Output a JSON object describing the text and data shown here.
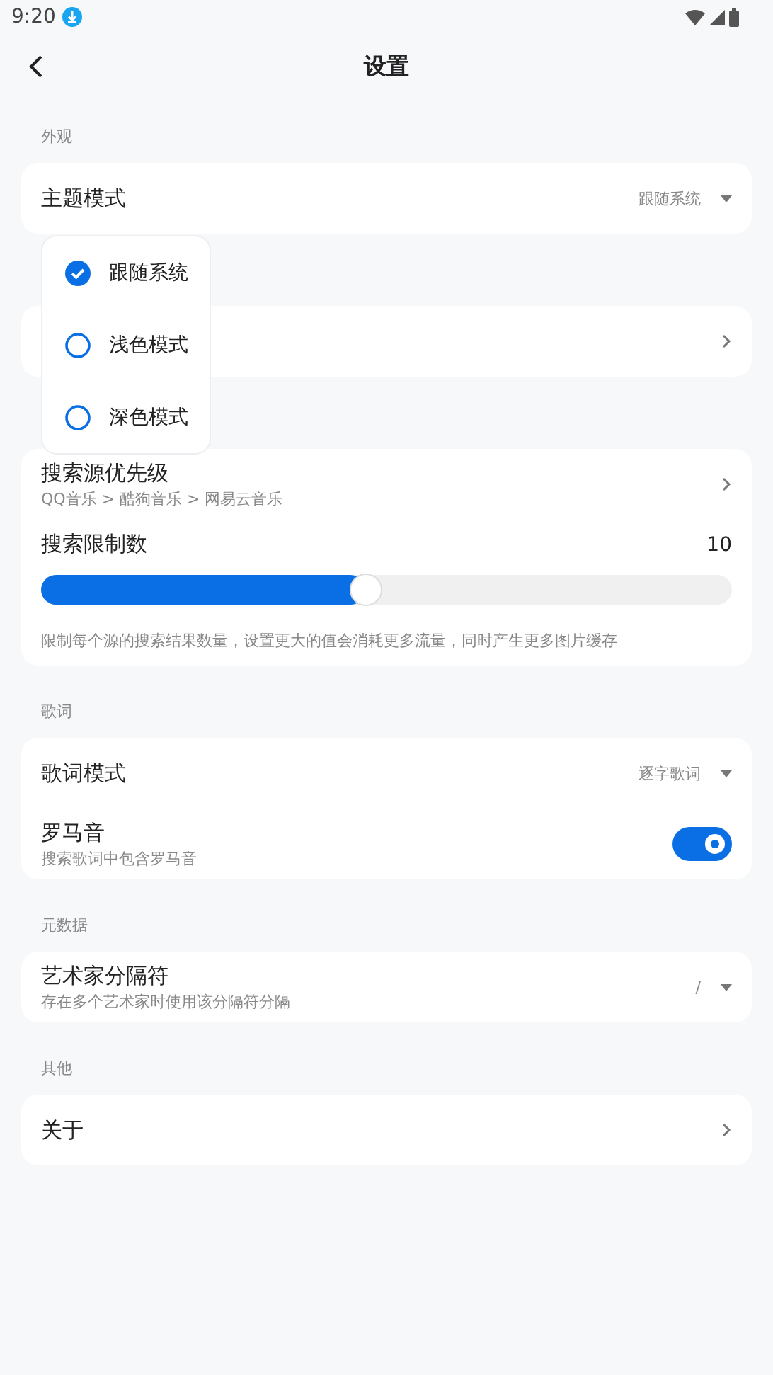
{
  "status_bar": {
    "time": "9:20"
  },
  "header": {
    "title": "设置"
  },
  "sections": [
    {
      "title": "外观",
      "items": [
        {
          "kind": "select",
          "label": "主题模式",
          "value": "跟随系统"
        }
      ]
    },
    {
      "items": [
        {
          "kind": "nav"
        }
      ]
    },
    {
      "items": [
        {
          "kind": "nav",
          "label": "搜索源优先级",
          "subtitle": "QQ音乐 > 酷狗音乐 > 网易云音乐"
        },
        {
          "kind": "slider",
          "label": "搜索限制数",
          "reading": "10",
          "level": 0.47,
          "hint": "限制每个源的搜索结果数量，设置更大的值会消耗更多流量，同时产生更多图片缓存"
        }
      ]
    },
    {
      "title": "歌词",
      "items": [
        {
          "kind": "select",
          "label": "歌词模式",
          "value": "逐字歌词"
        },
        {
          "kind": "switch",
          "label": "罗马音",
          "subtitle": "搜索歌词中包含罗马音",
          "on": true
        }
      ]
    },
    {
      "title": "元数据",
      "items": [
        {
          "kind": "select",
          "label": "艺术家分隔符",
          "subtitle": "存在多个艺术家时使用该分隔符分隔",
          "value": "/"
        }
      ]
    },
    {
      "title": "其他",
      "items": [
        {
          "kind": "nav",
          "label": "关于"
        }
      ]
    }
  ],
  "theme_menu": {
    "options": [
      {
        "label": "跟随系统",
        "selected": true
      },
      {
        "label": "浅色模式",
        "selected": false
      },
      {
        "label": "深色模式",
        "selected": false
      }
    ]
  }
}
